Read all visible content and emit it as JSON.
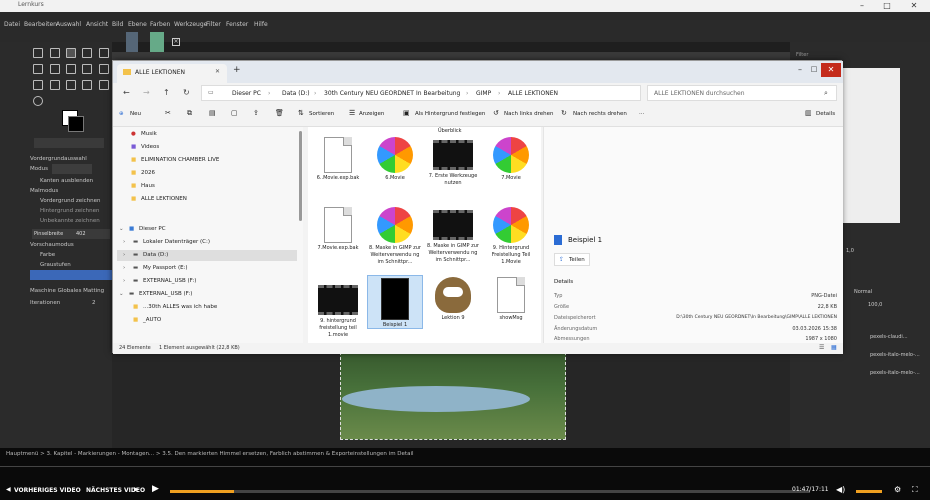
{
  "gimp": {
    "title": "Lernkurs",
    "menu": [
      "Datei",
      "Bearbeiten",
      "Auswahl",
      "Ansicht",
      "Bild",
      "Ebene",
      "Farben",
      "Werkzeuge",
      "Filter",
      "Fenster",
      "Hilfe"
    ],
    "left_dock": {
      "label_vg": "Vordergrundauswahl",
      "mode_label": "Modus",
      "cb_kanten": "Kanten ausblenden",
      "mode_header": "Malmodus",
      "opt1": "Vordergrund zeichnen",
      "opt2": "Hintergrund zeichnen",
      "opt3": "Unbekannte zeichnen",
      "pinsel_label": "Pinselbreite",
      "pinsel_val": "402",
      "preview_header": "Vorschaumodus",
      "prev1": "Farbe",
      "prev2": "Graustufen",
      "engine": "Maschine Globales Matting",
      "iter": "Iterationen",
      "iter_val": "2"
    },
    "right_dock": {
      "filter": "Filter",
      "normal": "Normal",
      "opacity": "100,0",
      "size": "1,0",
      "layers": [
        "pexels-claudi...",
        "pexels-italo-melo-...",
        "pexels-italo-melo-..."
      ]
    }
  },
  "explorer": {
    "tab": "ALLE LEKTIONEN",
    "add_tab": "+",
    "breadcrumb": [
      "Dieser PC",
      "Data (D:)",
      "30th Century NEU GEORDNET",
      "In Bearbeitung",
      "GIMP",
      "ALLE LEKTIONEN"
    ],
    "search_placeholder": "ALLE LEKTIONEN durchsuchen",
    "cmd": {
      "new": "Neu",
      "sort": "Sortieren",
      "view": "Anzeigen",
      "bg": "Als Hintergrund festlegen",
      "left": "Nach links drehen",
      "right": "Nach rechts drehen",
      "more": "···",
      "details": "Details"
    },
    "nav": [
      "Musik",
      "Videos",
      "ELIMINATION CHAMBER LIVE",
      "2026",
      "Haus",
      "ALLE LEKTIONEN",
      "Dieser PC",
      "Lokaler Datenträger (C:)",
      "Data (D:)",
      "My Passport (E:)",
      "EXTERNAL_USB (F:)",
      "EXTERNAL_USB (F:)",
      "...30th ALLES was ich habe",
      "_AUTO"
    ],
    "top_label": "Überblick",
    "files": [
      {
        "name": "6..Movie.exp.bak",
        "kind": "doc"
      },
      {
        "name": "6.Movie",
        "kind": "pin"
      },
      {
        "name": "7. Erste Werkzeuge nutzen",
        "kind": "film"
      },
      {
        "name": "7.Movie",
        "kind": "pin"
      },
      {
        "name": "7.Movie.exp.bak",
        "kind": "doc"
      },
      {
        "name": "8. Maske in GIMP zur Weiterverwendu ng im Schnittpr...",
        "kind": "pin"
      },
      {
        "name": "8. Maske in GIMP zur Weiterverwendu ng im Schnittpr...",
        "kind": "film"
      },
      {
        "name": "9. Hintergrund Freistellung Teil 1.Movie",
        "kind": "pin"
      },
      {
        "name": "9. hintergrund freistellung teil 1.movie",
        "kind": "film"
      },
      {
        "name": "Beispiel 1",
        "kind": "black"
      },
      {
        "name": "Lektion 9",
        "kind": "gimp"
      },
      {
        "name": "showMsg",
        "kind": "doc"
      }
    ],
    "preview": {
      "name": "Beispiel 1",
      "share": "Teilen",
      "details": "Details",
      "rows": [
        [
          "Typ",
          "PNG-Datei"
        ],
        [
          "Größe",
          "22,8 KB"
        ],
        [
          "Dateispeicherort",
          "D:\\30th Century NEU GEORDNET\\In Bearbeitung\\GIMP\\ALLE LEKTIONEN"
        ],
        [
          "Änderungsdatum",
          "03.03.2026 15:38"
        ],
        [
          "Abmessungen",
          "1987 x 1080"
        ]
      ]
    },
    "status": {
      "count": "24 Elemente",
      "selected": "1 Element ausgewählt (22,8 KB)"
    }
  },
  "player": {
    "breadcrumb": "Hauptmenü > 3. Kapitel - Markierungen - Montagen... > 3.5. Den markierten Himmel ersetzen, Farblich abstimmen & Exporteinstellungen im Detail",
    "prev": "VORHERIGES VIDEO",
    "next": "NÄCHSTES VIDEO",
    "time": "01:47/17:11",
    "progress": 0.1
  },
  "colors": {
    "accent": "#f0a020",
    "close": "#c42b1c"
  }
}
